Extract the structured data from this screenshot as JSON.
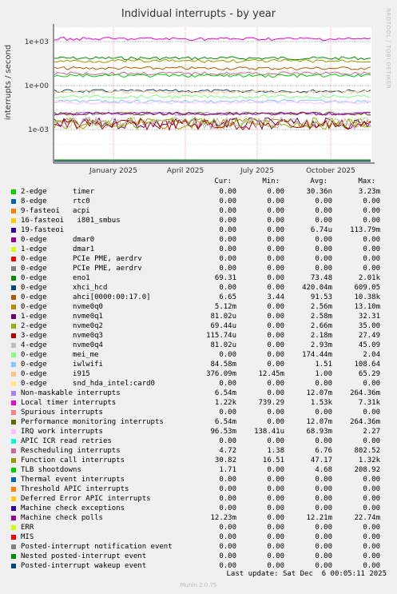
{
  "chart_data": {
    "type": "line",
    "title": "Individual interrupts - by year",
    "ylabel": "interrupts / second",
    "side_label": "RRDTOOL / TOBI OETIKER",
    "y_scale": "log",
    "y_ticks": [
      "1e-03",
      "1e+00",
      "1e+03"
    ],
    "x_ticks": [
      "January 2025",
      "April 2025",
      "July 2025",
      "October 2025"
    ],
    "grid": true,
    "columns": [
      "Cur:",
      "Min:",
      "Avg:",
      "Max:"
    ],
    "series": [
      {
        "name": "2-edge      timer",
        "color": "#00cc00",
        "cur": "0.00",
        "min": "0.00",
        "avg": "30.36n",
        "max": "3.23m",
        "level": 0.0
      },
      {
        "name": "8-edge      rtc0",
        "color": "#0066b3",
        "cur": "0.00",
        "min": "0.00",
        "avg": "0.00",
        "max": "0.00",
        "level": 0.0
      },
      {
        "name": "9-fasteoi   acpi",
        "color": "#ff8000",
        "cur": "0.00",
        "min": "0.00",
        "avg": "0.00",
        "max": "0.00",
        "level": 0.0
      },
      {
        "name": "16-fasteoi   i801_smbus",
        "color": "#ffcc00",
        "cur": "0.00",
        "min": "0.00",
        "avg": "0.00",
        "max": "0.00",
        "level": 0.0
      },
      {
        "name": "19-fasteoi",
        "color": "#330099",
        "cur": "0.00",
        "min": "0.00",
        "avg": "6.74u",
        "max": "113.79m",
        "level": 0.0
      },
      {
        "name": "0-edge      dmar0",
        "color": "#990099",
        "cur": "0.00",
        "min": "0.00",
        "avg": "0.00",
        "max": "0.00",
        "level": 0.0
      },
      {
        "name": "1-edge      dmar1",
        "color": "#ccff00",
        "cur": "0.00",
        "min": "0.00",
        "avg": "0.00",
        "max": "0.00",
        "level": 0.0
      },
      {
        "name": "0-edge      PCIe PME, aerdrv",
        "color": "#ff0000",
        "cur": "0.00",
        "min": "0.00",
        "avg": "0.00",
        "max": "0.00",
        "level": 0.0
      },
      {
        "name": "0-edge      PCIe PME, aerdrv",
        "color": "#808080",
        "cur": "0.00",
        "min": "0.00",
        "avg": "0.00",
        "max": "0.00",
        "level": 0.0
      },
      {
        "name": "0-edge      eno1",
        "color": "#008f00",
        "cur": "69.31",
        "min": "0.00",
        "avg": "73.48",
        "max": "2.01k",
        "level": 73.48
      },
      {
        "name": "0-edge      xhci_hcd",
        "color": "#00487d",
        "cur": "0.00",
        "min": "0.00",
        "avg": "420.04m",
        "max": "609.05",
        "level": 0.42
      },
      {
        "name": "0-edge      ahci[0000:00:17.0]",
        "color": "#b35a00",
        "cur": "6.65",
        "min": "3.44",
        "avg": "91.53",
        "max": "10.38k",
        "level": 15.0
      },
      {
        "name": "0-edge      nvme0q0",
        "color": "#b38f00",
        "cur": "5.12m",
        "min": "0.00",
        "avg": "2.56m",
        "max": "13.10m",
        "level": 0.00256
      },
      {
        "name": "1-edge      nvme0q1",
        "color": "#6b006b",
        "cur": "81.02u",
        "min": "0.00",
        "avg": "2.58m",
        "max": "32.31",
        "level": 0.00258
      },
      {
        "name": "2-edge      nvme0q2",
        "color": "#8fb300",
        "cur": "69.44u",
        "min": "0.00",
        "avg": "2.66m",
        "max": "35.00",
        "level": 0.00266
      },
      {
        "name": "3-edge      nvme0q3",
        "color": "#b30000",
        "cur": "115.74u",
        "min": "0.00",
        "avg": "2.18m",
        "max": "27.49",
        "level": 0.00218
      },
      {
        "name": "4-edge      nvme0q4",
        "color": "#bebebe",
        "cur": "81.02u",
        "min": "0.00",
        "avg": "2.93m",
        "max": "45.09",
        "level": 0.00293
      },
      {
        "name": "0-edge      mei_me",
        "color": "#80ff80",
        "cur": "0.00",
        "min": "0.00",
        "avg": "174.44m",
        "max": "2.04",
        "level": 0.174
      },
      {
        "name": "0-edge      iwlwifi",
        "color": "#80c9ff",
        "cur": "84.58m",
        "min": "0.00",
        "avg": "1.51",
        "max": "108.64",
        "level": 0.0846
      },
      {
        "name": "0-edge      i915",
        "color": "#ffc080",
        "cur": "376.09m",
        "min": "12.45m",
        "avg": "1.00",
        "max": "65.29",
        "level": 0.376
      },
      {
        "name": "0-edge      snd_hda_intel:card0",
        "color": "#ffe680",
        "cur": "0.00",
        "min": "0.00",
        "avg": "0.00",
        "max": "0.00",
        "level": 0.0
      },
      {
        "name": "Non-maskable interrupts",
        "color": "#aa80ff",
        "cur": "6.54m",
        "min": "0.00",
        "avg": "12.07m",
        "max": "264.36m",
        "level": 0.0121
      },
      {
        "name": "Local timer interrupts",
        "color": "#ee00cc",
        "cur": "1.22k",
        "min": "739.29",
        "avg": "1.53k",
        "max": "7.31k",
        "level": 1530
      },
      {
        "name": "Spurious interrupts",
        "color": "#ff8080",
        "cur": "0.00",
        "min": "0.00",
        "avg": "0.00",
        "max": "0.00",
        "level": 0.0
      },
      {
        "name": "Performance monitoring interrupts",
        "color": "#666600",
        "cur": "6.54m",
        "min": "0.00",
        "avg": "12.07m",
        "max": "264.36m",
        "level": 0.0121
      },
      {
        "name": "IRQ work interrupts",
        "color": "#ffbfff",
        "cur": "96.53m",
        "min": "138.41u",
        "avg": "68.93m",
        "max": "2.27",
        "level": 0.0689
      },
      {
        "name": "APIC ICR read retries",
        "color": "#00ffcc",
        "cur": "0.00",
        "min": "0.00",
        "avg": "0.00",
        "max": "0.00",
        "level": 0.0
      },
      {
        "name": "Rescheduling interrupts",
        "color": "#cc6699",
        "cur": "4.72",
        "min": "1.38",
        "avg": "6.76",
        "max": "802.52",
        "level": 6.76
      },
      {
        "name": "Function call interrupts",
        "color": "#999900",
        "cur": "30.82",
        "min": "16.51",
        "avg": "47.17",
        "max": "1.32k",
        "level": 47.17
      },
      {
        "name": "TLB shootdowns",
        "color": "#00cc00",
        "cur": "1.71",
        "min": "0.00",
        "avg": "4.68",
        "max": "208.92",
        "level": 4.68
      },
      {
        "name": "Thermal event interrupts",
        "color": "#0066b3",
        "cur": "0.00",
        "min": "0.00",
        "avg": "0.00",
        "max": "0.00",
        "level": 0.0
      },
      {
        "name": "Threshold APIC interrupts",
        "color": "#ff8000",
        "cur": "0.00",
        "min": "0.00",
        "avg": "0.00",
        "max": "0.00",
        "level": 0.0
      },
      {
        "name": "Deferred Error APIC interrupts",
        "color": "#ffcc00",
        "cur": "0.00",
        "min": "0.00",
        "avg": "0.00",
        "max": "0.00",
        "level": 0.0
      },
      {
        "name": "Machine check exceptions",
        "color": "#330099",
        "cur": "0.00",
        "min": "0.00",
        "avg": "0.00",
        "max": "0.00",
        "level": 0.0
      },
      {
        "name": "Machine check polls",
        "color": "#990099",
        "cur": "12.23m",
        "min": "0.00",
        "avg": "12.21m",
        "max": "22.74m",
        "level": 0.0122
      },
      {
        "name": "ERR",
        "color": "#ccff00",
        "cur": "0.00",
        "min": "0.00",
        "avg": "0.00",
        "max": "0.00",
        "level": 0.0
      },
      {
        "name": "MIS",
        "color": "#ff0000",
        "cur": "0.00",
        "min": "0.00",
        "avg": "0.00",
        "max": "0.00",
        "level": 0.0
      },
      {
        "name": "Posted-interrupt notification event",
        "color": "#808080",
        "cur": "0.00",
        "min": "0.00",
        "avg": "0.00",
        "max": "0.00",
        "level": 0.0
      },
      {
        "name": "Nested posted-interrupt event",
        "color": "#008f00",
        "cur": "0.00",
        "min": "0.00",
        "avg": "0.00",
        "max": "0.00",
        "level": 0.0
      },
      {
        "name": "Posted-interrupt wakeup event",
        "color": "#00487d",
        "cur": "0.00",
        "min": "0.00",
        "avg": "0.00",
        "max": "0.00",
        "level": 0.0
      }
    ]
  },
  "footer": "Last update: Sat Dec  6 00:05:11 2025",
  "version": "Munin 2.0.75"
}
